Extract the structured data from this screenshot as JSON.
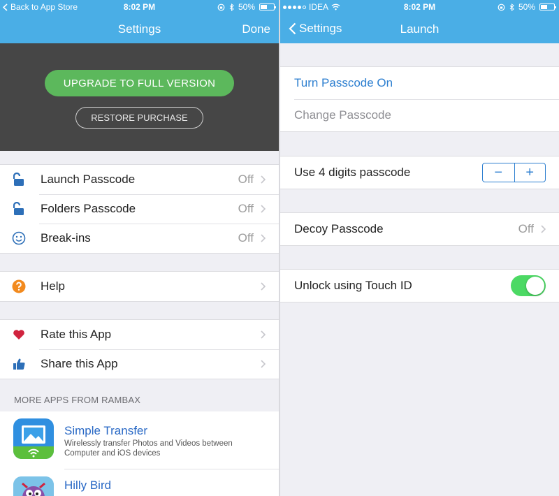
{
  "left": {
    "status": {
      "back_to": "Back to App Store",
      "time": "8:02 PM",
      "battery": "50%"
    },
    "nav": {
      "title": "Settings",
      "done": "Done"
    },
    "promo": {
      "upgrade": "UPGRADE TO FULL VERSION",
      "restore": "RESTORE PURCHASE"
    },
    "security": [
      {
        "label": "Launch Passcode",
        "value": "Off",
        "icon": "unlocked-padlock-icon"
      },
      {
        "label": "Folders Passcode",
        "value": "Off",
        "icon": "unlocked-padlock-icon"
      },
      {
        "label": "Break-ins",
        "value": "Off",
        "icon": "smiley-face-icon"
      }
    ],
    "help": {
      "label": "Help",
      "icon": "question-circle-icon"
    },
    "social": [
      {
        "label": "Rate this App",
        "icon": "heart-icon"
      },
      {
        "label": "Share this App",
        "icon": "thumbs-up-icon"
      }
    ],
    "more_apps": {
      "header": "MORE APPS FROM RAMBAX",
      "apps": [
        {
          "name": "Simple Transfer",
          "description": "Wirelessly transfer Photos and Videos between Computer and iOS devices",
          "icon": "simple-transfer-app-icon"
        },
        {
          "name": "Hilly Bird",
          "description": "",
          "icon": "hilly-bird-app-icon"
        }
      ]
    }
  },
  "right": {
    "status": {
      "carrier": "IDEA",
      "time": "8:02 PM",
      "battery": "50%"
    },
    "nav": {
      "back": "Settings",
      "title": "Launch"
    },
    "passcode": {
      "turn_on": "Turn Passcode On",
      "change": "Change Passcode"
    },
    "digits": {
      "label": "Use 4 digits passcode",
      "minus": "−",
      "plus": "+"
    },
    "decoy": {
      "label": "Decoy Passcode",
      "value": "Off"
    },
    "touch_id": {
      "label": "Unlock using Touch ID",
      "enabled": true
    }
  },
  "colors": {
    "nav_bar": "#4aaee6",
    "upgrade_button": "#5cb85c",
    "link_blue": "#2868c5",
    "toggle_on": "#4cd964",
    "promo_background": "#464646"
  }
}
